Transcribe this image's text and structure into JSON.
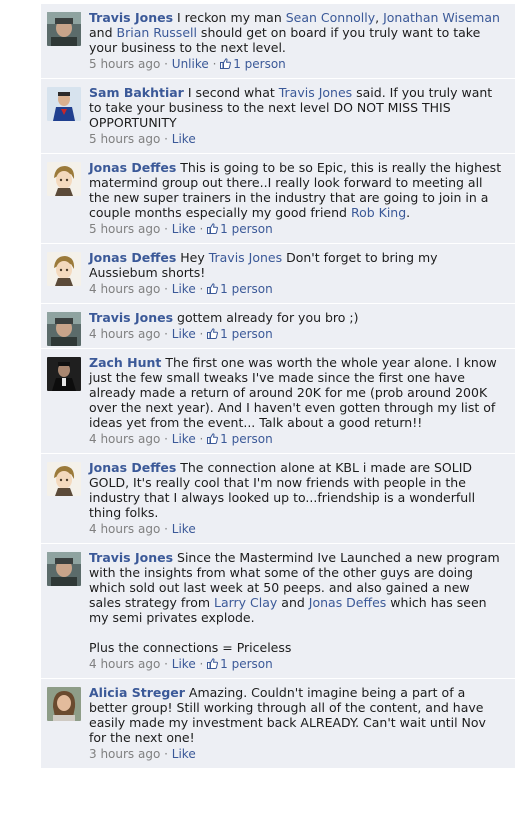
{
  "comments": [
    {
      "author": "Travis Jones",
      "avatar": "travis",
      "parts": [
        {
          "t": "text",
          "v": " I reckon my man "
        },
        {
          "t": "mention",
          "v": "Sean Connolly"
        },
        {
          "t": "text",
          "v": ", "
        },
        {
          "t": "mention",
          "v": "Jonathan Wiseman"
        },
        {
          "t": "text",
          "v": " and "
        },
        {
          "t": "mention",
          "v": "Brian Russell"
        },
        {
          "t": "text",
          "v": " should get on board if you truly want to take your business to the next level."
        }
      ],
      "time": "5 hours ago",
      "action": "Unlike",
      "likes": "1 person"
    },
    {
      "author": "Sam Bakhtiar",
      "avatar": "sam",
      "parts": [
        {
          "t": "text",
          "v": " I second what "
        },
        {
          "t": "mention",
          "v": "Travis Jones"
        },
        {
          "t": "text",
          "v": " said. If you truly want to take your business to the next level DO NOT MISS THIS OPPORTUNITY"
        }
      ],
      "time": "5 hours ago",
      "action": "Like",
      "likes": ""
    },
    {
      "author": "Jonas Deffes",
      "avatar": "jonas",
      "parts": [
        {
          "t": "text",
          "v": " This is going to be so Epic, this is really the highest matermind group out there..I really look forward to meeting all the new super trainers in the industry that are going to join in a couple months especially my good friend "
        },
        {
          "t": "mention",
          "v": "Rob King"
        },
        {
          "t": "text",
          "v": "."
        }
      ],
      "time": "5 hours ago",
      "action": "Like",
      "likes": "1 person"
    },
    {
      "author": "Jonas Deffes",
      "avatar": "jonas",
      "parts": [
        {
          "t": "text",
          "v": " Hey "
        },
        {
          "t": "mention",
          "v": "Travis Jones"
        },
        {
          "t": "text",
          "v": " Don't forget to bring my Aussiebum shorts!"
        }
      ],
      "time": "4 hours ago",
      "action": "Like",
      "likes": "1 person"
    },
    {
      "author": "Travis Jones",
      "avatar": "travis",
      "parts": [
        {
          "t": "text",
          "v": " gottem already for you bro ;)"
        }
      ],
      "time": "4 hours ago",
      "action": "Like",
      "likes": "1 person"
    },
    {
      "author": "Zach Hunt",
      "avatar": "zach",
      "parts": [
        {
          "t": "text",
          "v": " The first one was worth the whole year alone. I know just the few small tweaks I've made since the first one have already made a return of around 20K for me (prob around 200K over the next year). And I haven't even gotten through my list of ideas yet from the event... Talk about a good return!!"
        }
      ],
      "time": "4 hours ago",
      "action": "Like",
      "likes": "1 person"
    },
    {
      "author": "Jonas Deffes",
      "avatar": "jonas",
      "parts": [
        {
          "t": "text",
          "v": " The connection alone at KBL i made are SOLID GOLD, It's really cool that I'm now friends with people in the industry that I always looked up to...friendship is a wonderfull thing folks."
        }
      ],
      "time": "4 hours ago",
      "action": "Like",
      "likes": ""
    },
    {
      "author": "Travis Jones",
      "avatar": "travis",
      "parts": [
        {
          "t": "text",
          "v": " Since the Mastermind Ive Launched a new program with the insights from what some of the other guys are doing which sold out last week at 50 peeps. and also gained a new sales strategy from "
        },
        {
          "t": "mention",
          "v": "Larry Clay"
        },
        {
          "t": "text",
          "v": " and "
        },
        {
          "t": "mention",
          "v": "Jonas Deffes"
        },
        {
          "t": "text",
          "v": " which has seen my semi privates explode.\n\nPlus the connections = Priceless"
        }
      ],
      "time": "4 hours ago",
      "action": "Like",
      "likes": "1 person"
    },
    {
      "author": "Alicia Streger",
      "avatar": "alicia",
      "parts": [
        {
          "t": "text",
          "v": " Amazing. Couldn't imagine being a part of a better group! Still working through all of the content, and have easily made my investment back ALREADY. Can't wait until Nov for the next one!"
        }
      ],
      "time": "3 hours ago",
      "action": "Like",
      "likes": ""
    }
  ],
  "ui": {
    "separator": " · ",
    "thumb_icon": "thumbs-up-icon",
    "colors": {
      "link": "#3b5998",
      "meta": "#808080",
      "row_bg": "#edeff4"
    }
  }
}
